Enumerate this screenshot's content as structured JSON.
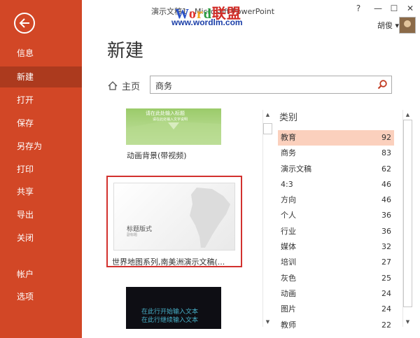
{
  "window": {
    "title": "演示文稿1 - Microsoft PowerPoint",
    "help": "?",
    "minimize": "—",
    "maximize": "☐",
    "close": "✕",
    "user": "胡俊 ▾"
  },
  "watermark": {
    "logo": "Word联盟",
    "url": "www.wordlm.com"
  },
  "sidebar": {
    "items": [
      {
        "label": "信息"
      },
      {
        "label": "新建"
      },
      {
        "label": "打开"
      },
      {
        "label": "保存"
      },
      {
        "label": "另存为"
      },
      {
        "label": "打印"
      },
      {
        "label": "共享"
      },
      {
        "label": "导出"
      },
      {
        "label": "关闭"
      },
      {
        "label": "帐户"
      },
      {
        "label": "选项"
      }
    ],
    "active": "新建"
  },
  "page": {
    "title": "新建",
    "home_label": "主页",
    "search_value": "商务"
  },
  "templates": [
    {
      "caption": "动画背景(带视频)",
      "thumb_title": "请在此处输入标题",
      "thumb_sub": "请在此处输入文字说明"
    },
    {
      "caption": "世界地图系列,南美洲演示文稿(...",
      "thumb_title": "标题版式",
      "thumb_sub": "副标题"
    },
    {
      "caption": "",
      "thumb_line1": "在此行开始输入文本",
      "thumb_line2": "在此行继续输入文本"
    }
  ],
  "categories": {
    "heading": "类别",
    "items": [
      {
        "name": "教育",
        "count": "92"
      },
      {
        "name": "商务",
        "count": "83"
      },
      {
        "name": "演示文稿",
        "count": "62"
      },
      {
        "name": "4:3",
        "count": "46"
      },
      {
        "name": "方向",
        "count": "46"
      },
      {
        "name": "个人",
        "count": "36"
      },
      {
        "name": "行业",
        "count": "36"
      },
      {
        "name": "媒体",
        "count": "32"
      },
      {
        "name": "培训",
        "count": "27"
      },
      {
        "name": "灰色",
        "count": "25"
      },
      {
        "name": "动画",
        "count": "24"
      },
      {
        "name": "图片",
        "count": "24"
      },
      {
        "name": "教师",
        "count": "22"
      }
    ]
  },
  "colors": {
    "accent": "#d24726",
    "active_nav": "#ac3a1e",
    "selected_category": "#fbd0bd",
    "selection_border": "#d2312e"
  }
}
